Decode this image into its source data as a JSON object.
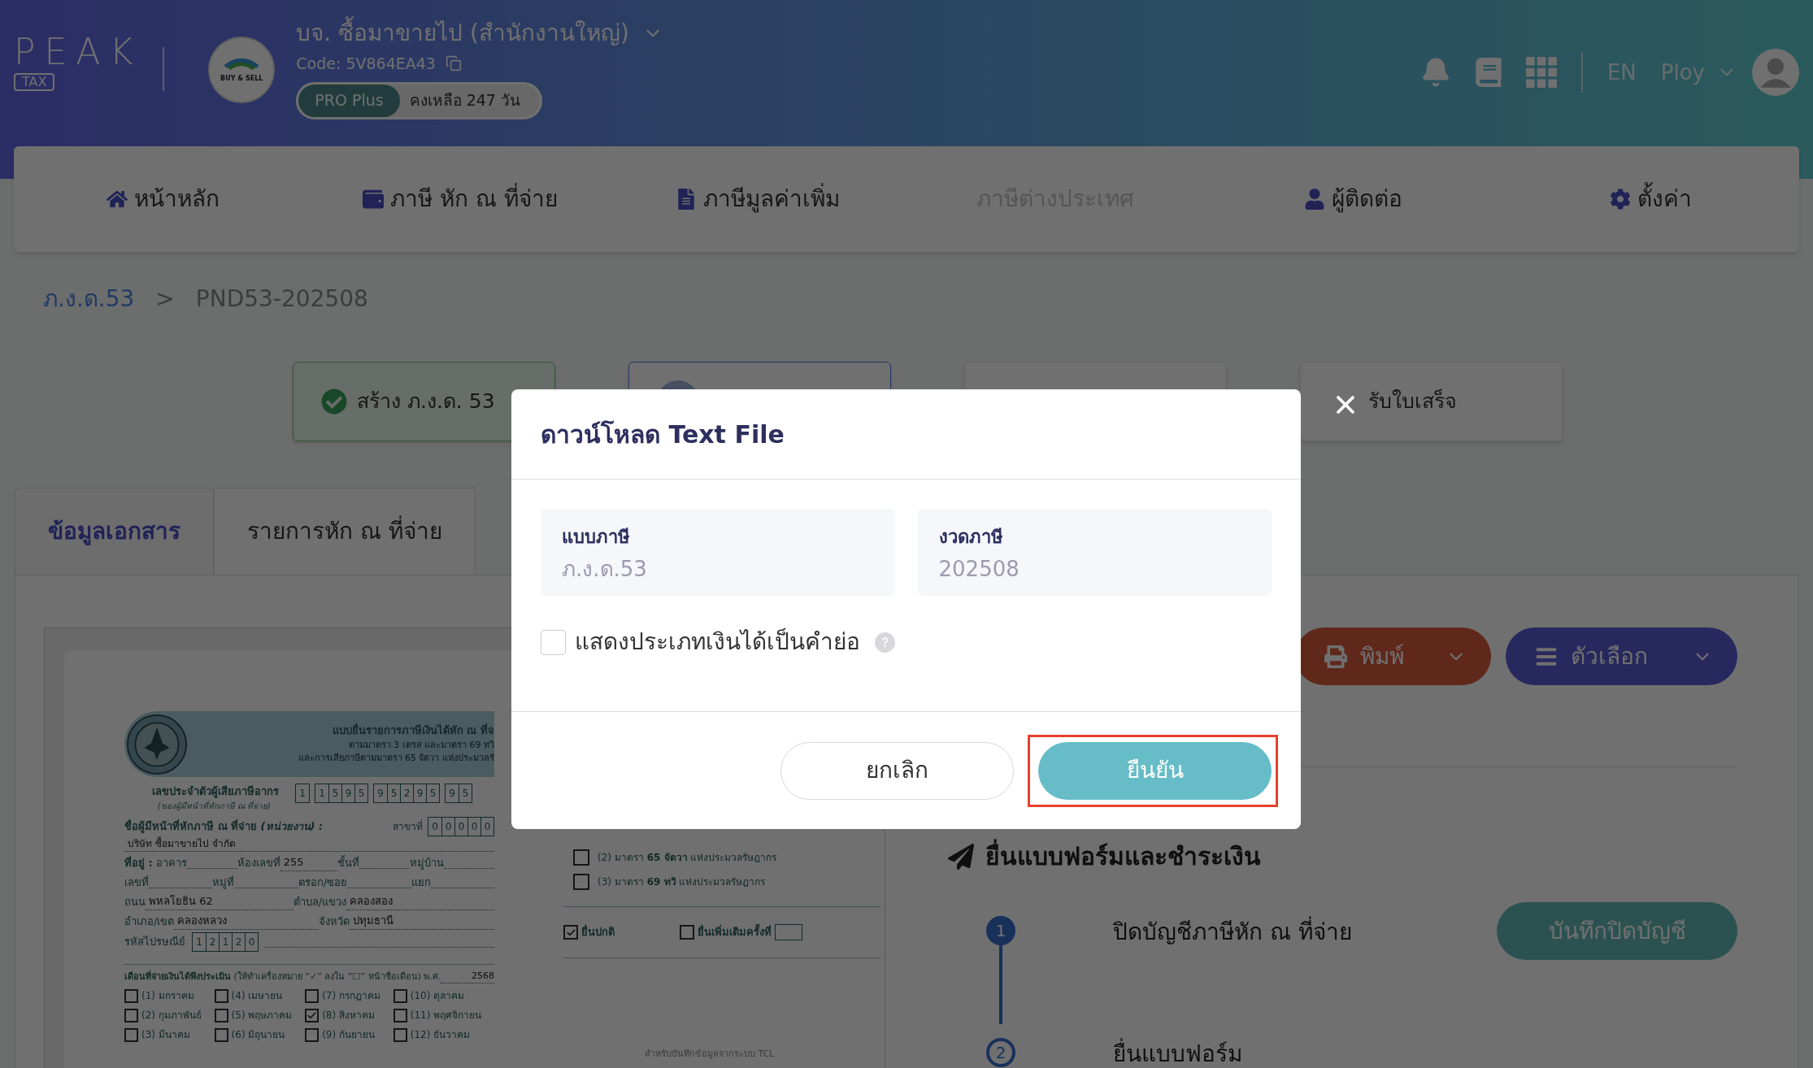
{
  "header": {
    "logo_word": "PEAK",
    "logo_tag": "TAX",
    "company_logo_text": "BUY & SELL",
    "company": "บจ. ซื้อมาขายไป (สำนักงานใหญ่)",
    "code": "Code: 5V864EA43",
    "plan": "PRO Plus",
    "remaining": "คงเหลือ 247 วัน",
    "language": "EN",
    "user": "Ploy"
  },
  "nav": [
    {
      "label": "หน้าหลัก",
      "kind": "home",
      "disabled": false
    },
    {
      "label": "ภาษี หัก ณ ที่จ่าย",
      "kind": "wallet",
      "disabled": false
    },
    {
      "label": "ภาษีมูลค่าเพิ่ม",
      "kind": "document",
      "disabled": false
    },
    {
      "label": "ภาษีต่างประเทศ",
      "kind": "plain",
      "disabled": true
    },
    {
      "label": "ผู้ติดต่อ",
      "kind": "user",
      "disabled": false
    },
    {
      "label": "ตั้งค่า",
      "kind": "gear",
      "disabled": false
    }
  ],
  "breadcrumb": {
    "items": [
      {
        "label": "ภ.ง.ด.53",
        "kind": "link"
      },
      {
        "label": "PND53-202508",
        "kind": "current"
      }
    ],
    "separator": ">"
  },
  "steps": [
    {
      "label": "สร้าง ภ.ง.ด. 53",
      "kind": "done"
    },
    {
      "kind": "current"
    },
    {
      "kind": "pending"
    },
    {
      "label": "รับใบเสร็จ",
      "kind": "pending"
    }
  ],
  "doc_tabs": [
    {
      "label": "ข้อมูลเอกสาร",
      "selected": true
    },
    {
      "label": "รายการหัก ณ ที่จ่าย",
      "selected": false
    }
  ],
  "form": {
    "title": "แบบยื่นรายการภาษีเงินได้หัก ณ ที่จ",
    "subtitle_lines": [
      "ตามมาตรา 3 เตรส และมาตรา 69 ทวิ",
      "และการเสียภาษีตามมาตรา 65 จัตวา แห่งประมวลรั"
    ],
    "tax_id_label": "เลขประจำตัวผู้เสียภาษีอากร",
    "tax_id_note": "(ของผู้มีหน้าที่หักภาษี ณ ที่จ่าย)",
    "tax_id_groups": [
      [
        "1"
      ],
      [
        "1",
        "5",
        "9",
        "5"
      ],
      [
        "9",
        "5",
        "2",
        "9",
        "5"
      ],
      [
        "9",
        "5"
      ]
    ],
    "payer_label": "ชื่อผู้มีหน้าที่หักภาษี ณ ที่จ่าย *(หน่วยงาน) :*",
    "branch_label": "สาขาที่",
    "branch_digits": [
      "0",
      "0",
      "0",
      "0",
      "0"
    ],
    "payer_name": "บริษัท ซื้อมาขายไป จำกัด",
    "address_rows": [
      [
        {
          "kind": "heading",
          "text": "ที่อยู่ :"
        },
        {
          "kind": "label",
          "text": "อาคาร"
        },
        {
          "kind": "blank"
        },
        {
          "kind": "label",
          "text": "ห้องเลขที่"
        },
        {
          "kind": "value",
          "text": "255"
        },
        {
          "kind": "label",
          "text": "ชั้นที่"
        },
        {
          "kind": "blank"
        },
        {
          "kind": "label",
          "text": "หมู่บ้าน"
        },
        {
          "kind": "blank"
        }
      ],
      [
        {
          "kind": "label",
          "text": "เลขที่"
        },
        {
          "kind": "blank"
        },
        {
          "kind": "label",
          "text": "หมู่ที่"
        },
        {
          "kind": "blank"
        },
        {
          "kind": "label",
          "text": "ตรอก/ซอย"
        },
        {
          "kind": "blank"
        },
        {
          "kind": "label",
          "text": "แยก"
        },
        {
          "kind": "blank"
        }
      ],
      [
        {
          "kind": "label",
          "text": "ถนน"
        },
        {
          "kind": "value",
          "text": "พหลโยธิน 62"
        },
        {
          "kind": "label",
          "text": "ตำบล/แขวง"
        },
        {
          "kind": "value",
          "text": "คลองสอง"
        }
      ],
      [
        {
          "kind": "label",
          "text": "อำเภอ/เขต"
        },
        {
          "kind": "value",
          "text": "คลองหลวง"
        },
        {
          "kind": "label",
          "text": "จังหวัด"
        },
        {
          "kind": "value",
          "text": "ปทุมธานี"
        }
      ]
    ],
    "postal_label": "รหัสไปรษณีย์",
    "postal_digits": [
      "1",
      "2",
      "1",
      "2",
      "0"
    ],
    "month_heading": "**เดือนที่จ่ายเงินได้พึงประเมิน** (ให้ทำเครื่องหมาย “✓” ลงใน “☐” หน้าชื่อเดือน) พ.ศ.",
    "year": "2568",
    "months": [
      {
        "label": "(1) มกราคม",
        "checked": false
      },
      {
        "label": "(2) กุมภาพันธ์",
        "checked": false
      },
      {
        "label": "(3) มีนาคม",
        "checked": false
      },
      {
        "label": "(4) เมษายน",
        "checked": false
      },
      {
        "label": "(5) พฤษภาคม",
        "checked": false
      },
      {
        "label": "(6) มิถุนายน",
        "checked": false
      },
      {
        "label": "(7) กรกฎาคม",
        "checked": false
      },
      {
        "label": "(8) สิงหาคม",
        "checked": true
      },
      {
        "label": "(9) กันยายน",
        "checked": false
      },
      {
        "label": "(10) ตุลาคม",
        "checked": false
      },
      {
        "label": "(11) พฤศจิกายน",
        "checked": false
      },
      {
        "label": "(12) ธันวาคม",
        "checked": false
      }
    ],
    "sections": [
      {
        "label": "(2) มาตรา **65 จัตวา** แห่งประมวลรัษฎากร",
        "checked": false
      },
      {
        "label": "(3) มาตรา **69 ทวิ** แห่งประมวลรัษฎากร",
        "checked": false
      }
    ],
    "filing_types": [
      {
        "label": "ยื่นปกติ",
        "checked": true,
        "kind": "plain"
      },
      {
        "label": "ยื่นเพิ่มเติมครั้งที่",
        "checked": false,
        "kind": "numbered"
      }
    ],
    "footer_note": "สำหรับบันทึกข้อมูลจากระบบ TCL"
  },
  "actions": [
    {
      "label": "พิมพ์",
      "kind": "print"
    },
    {
      "label": "ตัวเลือก",
      "kind": "options"
    }
  ],
  "filing": {
    "title": "ยื่นแบบฟอร์มและชำระเงิน",
    "steps": [
      {
        "number": "1",
        "label": "ปิดบัญชีภาษีหัก ณ ที่จ่าย",
        "button": "บันทึกปิดบัญชี"
      },
      {
        "number": "2",
        "label": "ยื่นแบบฟอร์ม"
      }
    ]
  },
  "dialog": {
    "title": "ดาวน์โหลด Text File",
    "fields": [
      {
        "label": "แบบภาษี",
        "value": "ภ.ง.ด.53"
      },
      {
        "label": "งวดภาษี",
        "value": "202508"
      }
    ],
    "option": {
      "label": "แสดงประเภทเงินได้เป็นคำย่อ",
      "checked": false
    },
    "buttons": [
      {
        "label": "ยกเลิก",
        "kind": "secondary",
        "highlighted": false
      },
      {
        "label": "ยืนยัน",
        "kind": "primary",
        "highlighted": true
      }
    ]
  }
}
